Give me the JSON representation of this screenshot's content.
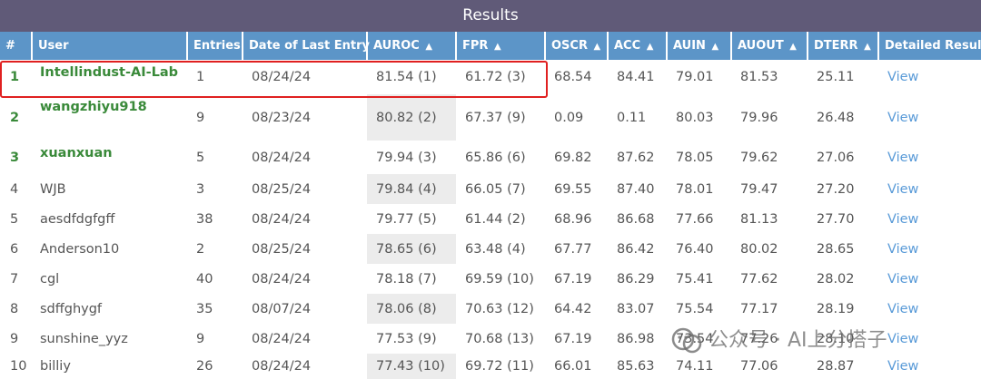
{
  "title": "Results",
  "headers": {
    "rank": "#",
    "user": "User",
    "entries": "Entries",
    "date": "Date of Last Entry",
    "auroc": "AUROC",
    "fpr": "FPR",
    "oscr": "OSCR",
    "acc": "ACC",
    "auin": "AUIN",
    "auout": "AUOUT",
    "dterr": "DTERR",
    "details": "Detailed Results",
    "sort_glyph": "▲"
  },
  "rows": [
    {
      "rank": "1",
      "user": "Intellindust-AI-Lab",
      "entries": "1",
      "date": "08/24/24",
      "auroc": "81.54 (1)",
      "fpr": "61.72 (3)",
      "oscr": "68.54",
      "acc": "84.41",
      "auin": "79.01",
      "auout": "81.53",
      "dterr": "25.11",
      "view": "View"
    },
    {
      "rank": "2",
      "user": "wangzhiyu918",
      "entries": "9",
      "date": "08/23/24",
      "auroc": "80.82 (2)",
      "fpr": "67.37 (9)",
      "oscr": "0.09",
      "acc": "0.11",
      "auin": "80.03",
      "auout": "79.96",
      "dterr": "26.48",
      "view": "View"
    },
    {
      "rank": "3",
      "user": "xuanxuan",
      "entries": "5",
      "date": "08/24/24",
      "auroc": "79.94 (3)",
      "fpr": "65.86 (6)",
      "oscr": "69.82",
      "acc": "87.62",
      "auin": "78.05",
      "auout": "79.62",
      "dterr": "27.06",
      "view": "View"
    },
    {
      "rank": "4",
      "user": "WJB",
      "entries": "3",
      "date": "08/25/24",
      "auroc": "79.84 (4)",
      "fpr": "66.05 (7)",
      "oscr": "69.55",
      "acc": "87.40",
      "auin": "78.01",
      "auout": "79.47",
      "dterr": "27.20",
      "view": "View"
    },
    {
      "rank": "5",
      "user": "aesdfdgfgff",
      "entries": "38",
      "date": "08/24/24",
      "auroc": "79.77 (5)",
      "fpr": "61.44 (2)",
      "oscr": "68.96",
      "acc": "86.68",
      "auin": "77.66",
      "auout": "81.13",
      "dterr": "27.70",
      "view": "View"
    },
    {
      "rank": "6",
      "user": "Anderson10",
      "entries": "2",
      "date": "08/25/24",
      "auroc": "78.65 (6)",
      "fpr": "63.48 (4)",
      "oscr": "67.77",
      "acc": "86.42",
      "auin": "76.40",
      "auout": "80.02",
      "dterr": "28.65",
      "view": "View"
    },
    {
      "rank": "7",
      "user": "cgl",
      "entries": "40",
      "date": "08/24/24",
      "auroc": "78.18 (7)",
      "fpr": "69.59 (10)",
      "oscr": "67.19",
      "acc": "86.29",
      "auin": "75.41",
      "auout": "77.62",
      "dterr": "28.02",
      "view": "View"
    },
    {
      "rank": "8",
      "user": "sdffghygf",
      "entries": "35",
      "date": "08/07/24",
      "auroc": "78.06 (8)",
      "fpr": "70.63 (12)",
      "oscr": "64.42",
      "acc": "83.07",
      "auin": "75.54",
      "auout": "77.17",
      "dterr": "28.19",
      "view": "View"
    },
    {
      "rank": "9",
      "user": "sunshine_yyz",
      "entries": "9",
      "date": "08/24/24",
      "auroc": "77.53 (9)",
      "fpr": "70.68 (13)",
      "oscr": "67.19",
      "acc": "86.98",
      "auin": "73.54",
      "auout": "77.26",
      "dterr": "28.10",
      "view": "View"
    },
    {
      "rank": "10",
      "user": "billiy",
      "entries": "26",
      "date": "08/24/24",
      "auroc": "77.43 (10)",
      "fpr": "69.72 (11)",
      "oscr": "66.01",
      "acc": "85.63",
      "auin": "74.11",
      "auout": "77.06",
      "dterr": "28.87",
      "view": "View"
    }
  ],
  "watermark": "公众号 · AI上分搭子",
  "colors": {
    "title_bar": "#605a78",
    "header": "#5c95c8",
    "top_rank": "#3a8a3a",
    "link": "#5a9bd8",
    "highlight_box": "#e02020",
    "shade": "#ececec"
  }
}
